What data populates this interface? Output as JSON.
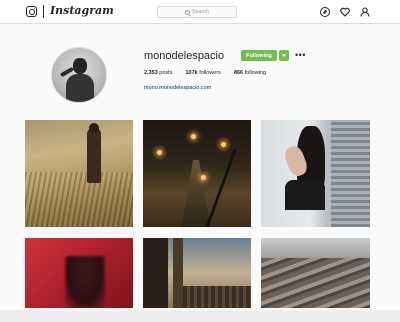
{
  "app": {
    "wordmark": "Instagram",
    "search_placeholder": "Search"
  },
  "profile": {
    "username": "monodelespacio",
    "follow_button": "Following",
    "more": "•••",
    "stats": {
      "posts_value": "2,353",
      "posts_label": "posts",
      "followers_value": "107k",
      "followers_label": "followers",
      "following_value": "866",
      "following_label": "following"
    },
    "link": "mono.monodelespacio.com"
  },
  "colors": {
    "follow_green": "#70c050",
    "link_blue": "#003569"
  },
  "icons": {
    "logo": "instagram-glyph-icon",
    "search": "search-icon",
    "explore": "compass-icon",
    "activity": "heart-icon",
    "profile": "person-icon"
  },
  "grid": {
    "posts": [
      {
        "id": "post-1",
        "subject": "woman-in-field"
      },
      {
        "id": "post-2",
        "subject": "night-street"
      },
      {
        "id": "post-3",
        "subject": "woman-by-window"
      },
      {
        "id": "post-4",
        "subject": "red-portrait"
      },
      {
        "id": "post-5",
        "subject": "balcony-city"
      },
      {
        "id": "post-6",
        "subject": "rooftops"
      }
    ]
  }
}
